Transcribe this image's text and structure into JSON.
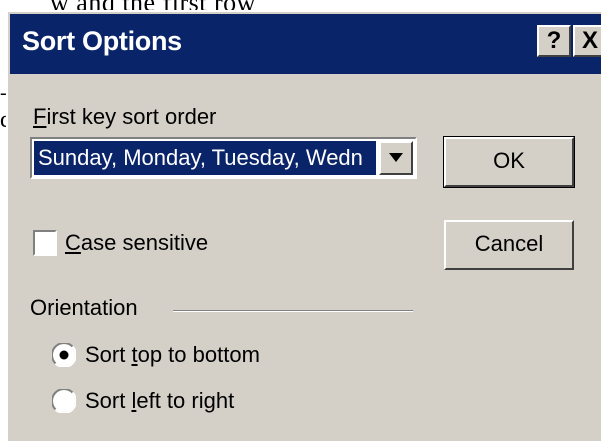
{
  "background": {
    "line1": "w and the first row",
    "dash": "-",
    "fragment": "d"
  },
  "dialog": {
    "title": "Sort Options",
    "help_label": "?",
    "close_label": "X"
  },
  "first_key": {
    "label_accel": "F",
    "label_rest": "irst key sort order",
    "selected": "Sunday, Monday, Tuesday, Wedn"
  },
  "buttons": {
    "ok": "OK",
    "cancel": "Cancel"
  },
  "case_sensitive": {
    "label_accel": "C",
    "label_rest": "ase sensitive",
    "checked": false
  },
  "orientation": {
    "label": "Orientation",
    "options": [
      {
        "pre": "Sort ",
        "accel": "t",
        "post": "op to bottom",
        "selected": true
      },
      {
        "pre": "Sort ",
        "accel": "l",
        "post": "eft to right",
        "selected": false
      }
    ]
  }
}
